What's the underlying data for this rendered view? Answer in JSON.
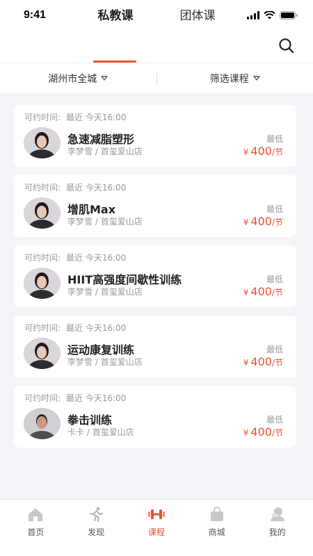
{
  "status": {
    "time": "9:41"
  },
  "tabs": {
    "private": "私教课",
    "group": "团体课"
  },
  "filters": {
    "city": "湖州市全城",
    "course": "筛选课程"
  },
  "cards": [
    {
      "time_label": "可约时间:",
      "time_value": "最近  今天16:00",
      "title": "急速减脂塑形",
      "coach": "李梦雪",
      "store": "首玺爱山店",
      "min_label": "最低",
      "currency": "¥",
      "price": "400",
      "unit": "/节"
    },
    {
      "time_label": "可约时间:",
      "time_value": "最近  今天16:00",
      "title": "增肌Max",
      "coach": "李梦雪",
      "store": "首玺爱山店",
      "min_label": "最低",
      "currency": "¥",
      "price": "400",
      "unit": "/节"
    },
    {
      "time_label": "可约时间:",
      "time_value": "最近  今天16:00",
      "title": "HIIT高强度间歇性训练",
      "coach": "李梦雪",
      "store": "首玺爱山店",
      "min_label": "最低",
      "currency": "¥",
      "price": "400",
      "unit": "/节"
    },
    {
      "time_label": "可约时间:",
      "time_value": "最近  今天16:00",
      "title": "运动康复训练",
      "coach": "李梦雪",
      "store": "首玺爱山店",
      "min_label": "最低",
      "currency": "¥",
      "price": "400",
      "unit": "/节"
    },
    {
      "time_label": "可约时间:",
      "time_value": "最近  今天16:00",
      "title": "拳击训练",
      "coach": "卡卡",
      "store": "首玺爱山店",
      "min_label": "最低",
      "currency": "¥",
      "price": "400",
      "unit": "/节"
    }
  ],
  "tabbar": [
    {
      "label": "首页",
      "icon": "home-icon"
    },
    {
      "label": "发现",
      "icon": "runner-icon"
    },
    {
      "label": "课程",
      "icon": "dumbbell-icon",
      "active": true
    },
    {
      "label": "商城",
      "icon": "shopping-bag-icon"
    },
    {
      "label": "我的",
      "icon": "profile-icon"
    }
  ],
  "colors": {
    "accent": "#e8532e",
    "background": "#f4f5f9",
    "muted": "#999999"
  }
}
